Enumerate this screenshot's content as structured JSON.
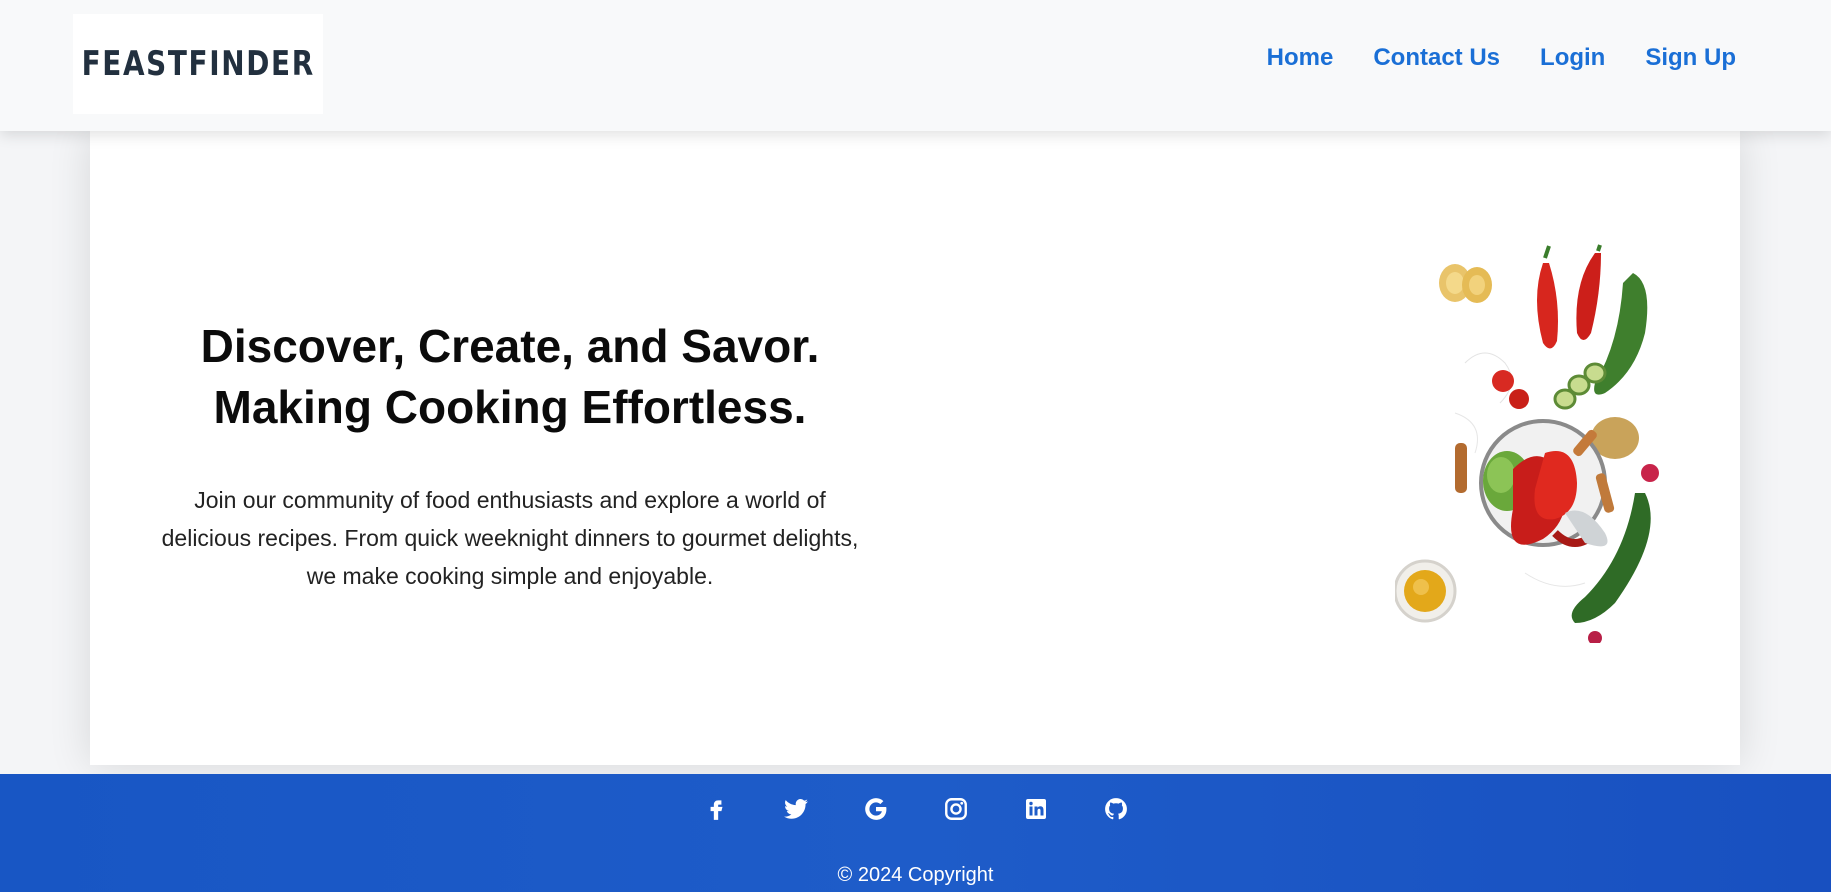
{
  "header": {
    "logo_text": "FEASTFINDER",
    "nav": [
      {
        "label": "Home"
      },
      {
        "label": "Contact Us"
      },
      {
        "label": "Login"
      },
      {
        "label": "Sign Up"
      }
    ]
  },
  "hero": {
    "title_line1": "Discover, Create, and Savor.",
    "title_line2": "Making Cooking Effortless.",
    "subtitle": "Join our community of food enthusiasts and explore a world of delicious recipes. From quick weeknight dinners to gourmet delights, we make cooking simple and enjoyable.",
    "image_icon": "vegetables-illustration"
  },
  "footer": {
    "social_icons": [
      "facebook-icon",
      "twitter-icon",
      "google-icon",
      "instagram-icon",
      "linkedin-icon",
      "github-icon"
    ],
    "copyright": "© 2024 Copyright"
  },
  "colors": {
    "nav_link": "#1a6fd6",
    "footer_bg": "#1e5cc9",
    "logo_text": "#22303f"
  }
}
